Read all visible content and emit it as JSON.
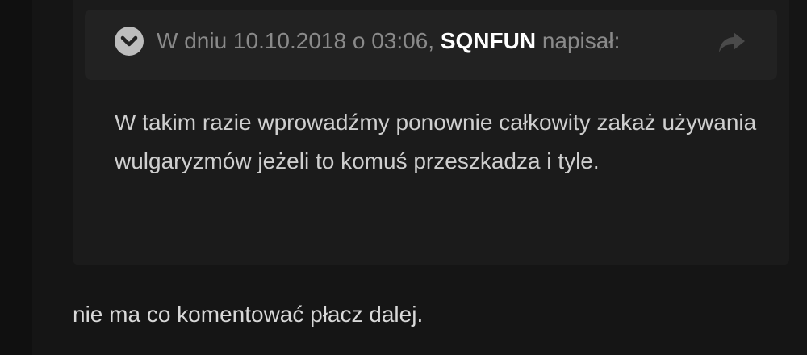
{
  "quote": {
    "citation_prefix": "W dniu 10.10.2018 o 03:06, ",
    "author": "SQNFUN",
    "citation_suffix": " napisał:",
    "toggle_icon": "chevron-down-icon",
    "share_icon": "share-arrow-icon",
    "text": "W takim razie wprowadźmy ponownie całkowity zakaż używania wulgaryzmów jeżeli to komuś przeszkadza i tyle."
  },
  "post": {
    "text": "nie ma co komentować płacz dalej."
  },
  "colors": {
    "background": "#151515",
    "quote_background": "#1b1b1b",
    "quote_header_background": "#222222",
    "author_text": "#ffffff",
    "muted_text": "#8a8a8a",
    "body_text": "#d8d8d8"
  }
}
